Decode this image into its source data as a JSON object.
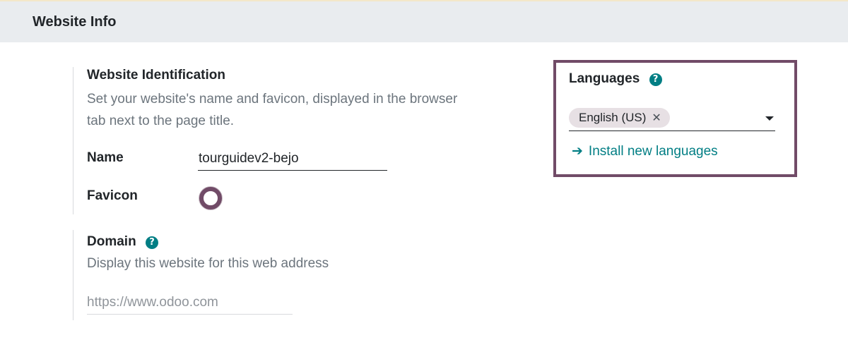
{
  "section": {
    "title": "Website Info"
  },
  "identification": {
    "title": "Website Identification",
    "description_line1": "Set your website's name and favicon, displayed in the browser",
    "description_line2": "tab next to the page title.",
    "name_label": "Name",
    "name_value": "tourguidev2-bejo",
    "favicon_label": "Favicon"
  },
  "domain": {
    "title": "Domain",
    "help_icon": "?",
    "description": "Display this website for this web address",
    "placeholder": "https://www.odoo.com"
  },
  "languages": {
    "title": "Languages",
    "help_icon": "?",
    "tags": [
      {
        "label": "English (US)",
        "remove": "✕"
      }
    ],
    "install_arrow": "➔",
    "install_label": "Install new languages"
  },
  "colors": {
    "accent": "#714b67",
    "link": "#017e84",
    "header_bg": "#e9ecef"
  }
}
